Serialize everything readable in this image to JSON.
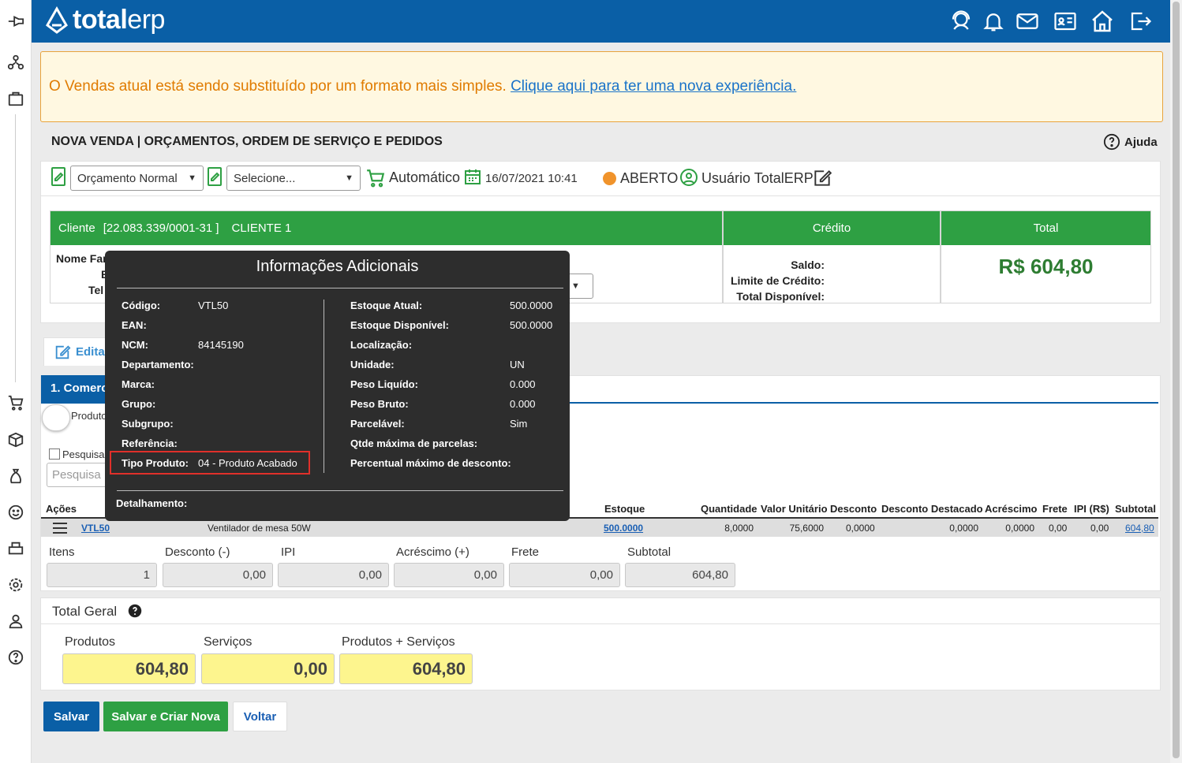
{
  "brand": {
    "logo_bold": "total",
    "logo_light": "erp"
  },
  "alert": {
    "text": "O Vendas atual está sendo substituído por um formato mais simples.",
    "link": "Clique aqui para ter uma nova experiência."
  },
  "page": {
    "title": "NOVA VENDA | ORÇAMENTOS, ORDEM DE SERVIÇO E PEDIDOS",
    "help": "Ajuda"
  },
  "toolbar": {
    "type_select": "Orçamento Normal",
    "second_select": "Selecione...",
    "mode": "Automático",
    "datetime": "16/07/2021 10:41",
    "status": "ABERTO",
    "user": "Usuário TotalERP"
  },
  "client": {
    "header_label": "Cliente",
    "doc": "[22.083.339/0001-31 ]",
    "name": "CLIENTE 1",
    "field_nome": "Nome Far",
    "field_e": "E",
    "field_tel": "Tel"
  },
  "credit": {
    "header": "Crédito",
    "saldo": "Saldo:",
    "limite": "Limite de Crédito:",
    "disponivel": "Total Disponível:"
  },
  "total": {
    "header": "Total",
    "value": "R$ 604,80"
  },
  "tabs": {
    "edit": "Editar",
    "comercial": "1. Comerci"
  },
  "search": {
    "toggle_label": "Produto",
    "checkbox_label": "Pesquisa",
    "placeholder": "Pesquisa"
  },
  "tooltip": {
    "title": "Informações Adicionais",
    "left": [
      {
        "k": "Código:",
        "v": "VTL50"
      },
      {
        "k": "EAN:",
        "v": ""
      },
      {
        "k": "NCM:",
        "v": "84145190"
      },
      {
        "k": "Departamento:",
        "v": ""
      },
      {
        "k": "Marca:",
        "v": ""
      },
      {
        "k": "Grupo:",
        "v": ""
      },
      {
        "k": "Subgrupo:",
        "v": ""
      },
      {
        "k": "Referência:",
        "v": ""
      },
      {
        "k": "Tipo Produto:",
        "v": "04 - Produto Acabado"
      }
    ],
    "right": [
      {
        "k": "Estoque Atual:",
        "v": "500.0000"
      },
      {
        "k": "Estoque Disponível:",
        "v": "500.0000"
      },
      {
        "k": "Localização:",
        "v": ""
      },
      {
        "k": "Unidade:",
        "v": "UN"
      },
      {
        "k": "Peso Liquído:",
        "v": "0.000"
      },
      {
        "k": "Peso Bruto:",
        "v": "0.000"
      },
      {
        "k": "Parcelável:",
        "v": "Sim"
      },
      {
        "k": "Qtde máxima de parcelas:",
        "v": ""
      },
      {
        "k": "Percentual máximo de desconto:",
        "v": ""
      }
    ],
    "detail": "Detalhamento:"
  },
  "table": {
    "headers": {
      "acoes": "Ações",
      "estoque": "Estoque",
      "quantidade": "Quantidade",
      "valor": "Valor Unitário",
      "desconto": "Desconto",
      "destacado": "Desconto Destacado",
      "acrescimo": "Acréscimo",
      "frete": "Frete",
      "ipi": "IPI (R$)",
      "subtotal": "Subtotal"
    },
    "row": {
      "code": "VTL50",
      "desc": "Ventilador de mesa 50W",
      "estoque": "500.0000",
      "quantidade": "8,0000",
      "valor": "75,6000",
      "desconto": "0,0000",
      "destacado": "0,0000",
      "acrescimo": "0,0000",
      "frete": "0,00",
      "ipi": "0,00",
      "subtotal": "604,80"
    }
  },
  "summary": {
    "itens_label": "Itens",
    "itens": "1",
    "desconto_label": "Desconto (-)",
    "desconto": "0,00",
    "ipi_label": "IPI",
    "ipi": "0,00",
    "acrescimo_label": "Acréscimo (+)",
    "acrescimo": "0,00",
    "frete_label": "Frete",
    "frete": "0,00",
    "subtotal_label": "Subtotal",
    "subtotal": "604,80"
  },
  "totals": {
    "title": "Total Geral",
    "produtos_label": "Produtos",
    "produtos": "604,80",
    "servicos_label": "Serviços",
    "servicos": "0,00",
    "ambos_label": "Produtos + Serviços",
    "ambos": "604,80"
  },
  "buttons": {
    "save": "Salvar",
    "save_new": "Salvar e Criar Nova",
    "back": "Voltar"
  }
}
